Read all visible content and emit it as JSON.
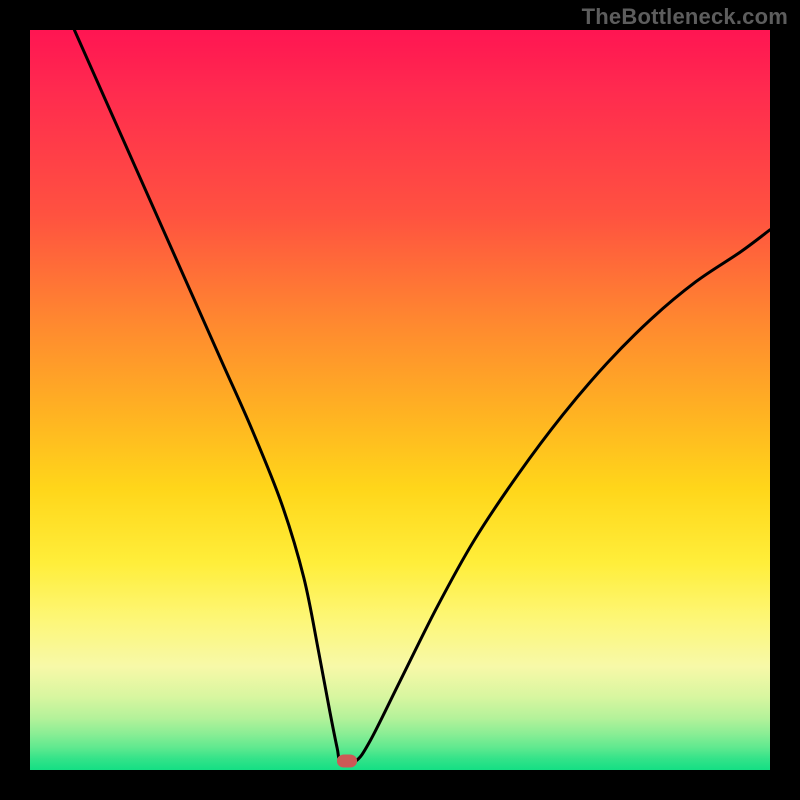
{
  "watermark": "TheBottleneck.com",
  "chart_data": {
    "type": "line",
    "title": "",
    "xlabel": "",
    "ylabel": "",
    "xlim": [
      0,
      100
    ],
    "ylim": [
      0,
      100
    ],
    "grid": false,
    "series": [
      {
        "name": "curve",
        "x": [
          6,
          10,
          14,
          18,
          22,
          26,
          30,
          34,
          37,
          39,
          40.5,
          41.5,
          42,
          44,
          46,
          50,
          55,
          60,
          66,
          72,
          78,
          84,
          90,
          96,
          100
        ],
        "y": [
          100,
          91,
          82,
          73,
          64,
          55,
          46,
          36,
          26,
          16,
          8,
          3,
          1.2,
          1.2,
          4,
          12,
          22,
          31,
          40,
          48,
          55,
          61,
          66,
          70,
          73
        ]
      }
    ],
    "marker": {
      "x": 42.8,
      "y": 1.2,
      "color": "#cc5a56"
    },
    "colors": {
      "gradient_top": "#ff1552",
      "gradient_mid": "#ffd61a",
      "gradient_bottom": "#14df84",
      "curve": "#000000",
      "frame": "#000000"
    }
  }
}
